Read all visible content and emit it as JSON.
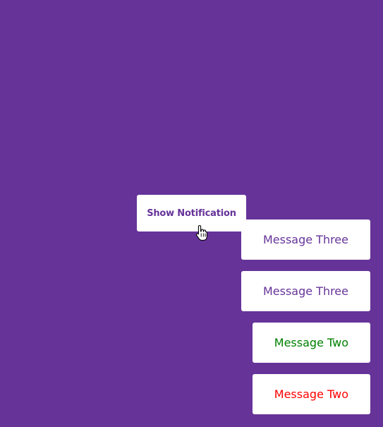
{
  "button": {
    "label": "Show Notification"
  },
  "notifications": [
    {
      "text": "Message Three",
      "color": "#663399"
    },
    {
      "text": "Message Three",
      "color": "#663399"
    },
    {
      "text": "Message Two",
      "color": "#008000"
    },
    {
      "text": "Message Two",
      "color": "#ff0000"
    }
  ],
  "colors": {
    "background": "#663399",
    "button_text": "#663399"
  },
  "icons": {
    "cursor": "hand-pointer-icon"
  }
}
